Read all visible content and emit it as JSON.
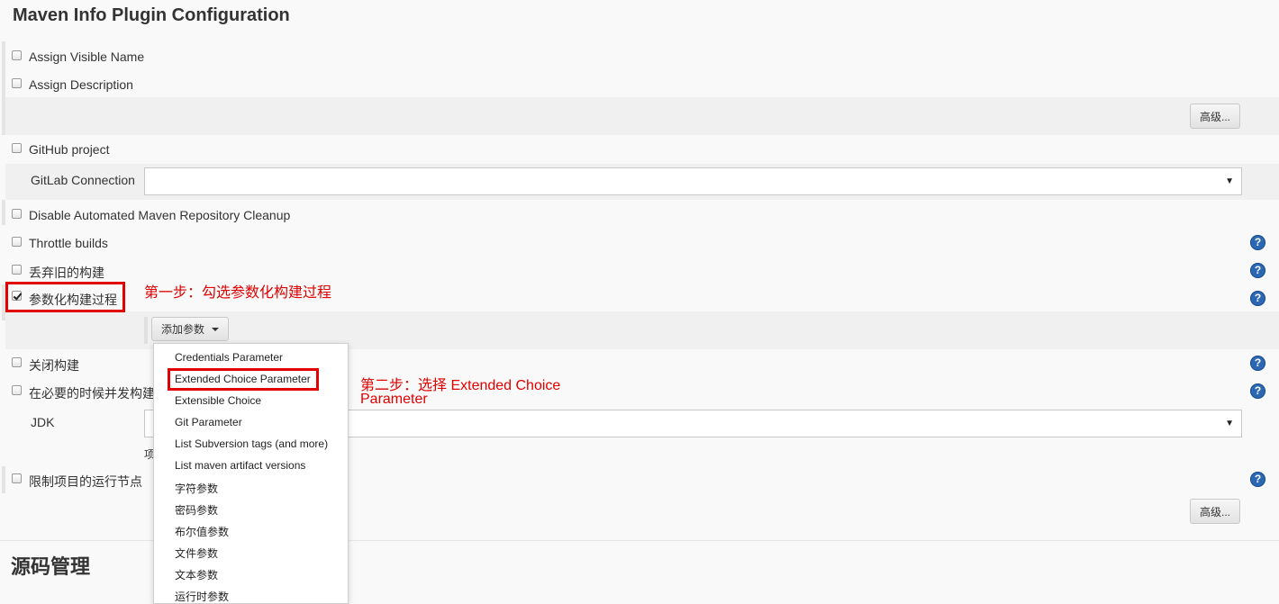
{
  "page": {
    "title": "Maven Info Plugin Configuration",
    "section_title": "源码管理"
  },
  "options": {
    "assign_visible_name": "Assign Visible Name",
    "assign_description": "Assign Description",
    "github_project": "GitHub project",
    "gitlab_connection": "GitLab Connection",
    "disable_maven_cleanup": "Disable Automated Maven Repository Cleanup",
    "throttle_builds": "Throttle builds",
    "discard_old_builds": "丢弃旧的构建",
    "parameterized": "参数化构建过程",
    "disable_build": "关闭构建",
    "concurrent_builds": "在必要的时候并发构建",
    "jdk": "JDK",
    "restrict_node": "限制项目的运行节点",
    "jdk_hint": "项"
  },
  "buttons": {
    "advanced": "高级...",
    "add_param": "添加参数"
  },
  "dropdown": {
    "items": [
      "Credentials Parameter",
      "Extended Choice Parameter",
      "Extensible Choice",
      "Git Parameter",
      "List Subversion tags (and more)",
      "List maven artifact versions",
      "字符参数",
      "密码参数",
      "布尔值参数",
      "文件参数",
      "文本参数",
      "运行时参数"
    ]
  },
  "annotations": {
    "step1": "第一步：勾选参数化构建过程",
    "step2_line1": "第二步：选择 Extended Choice",
    "step2_line2": "Parameter"
  },
  "icons": {
    "help": "help-icon",
    "check": "checkbox",
    "caret": "chevron-down-icon"
  },
  "colors": {
    "annotation": "#e00000",
    "help": "#2b67b3"
  }
}
